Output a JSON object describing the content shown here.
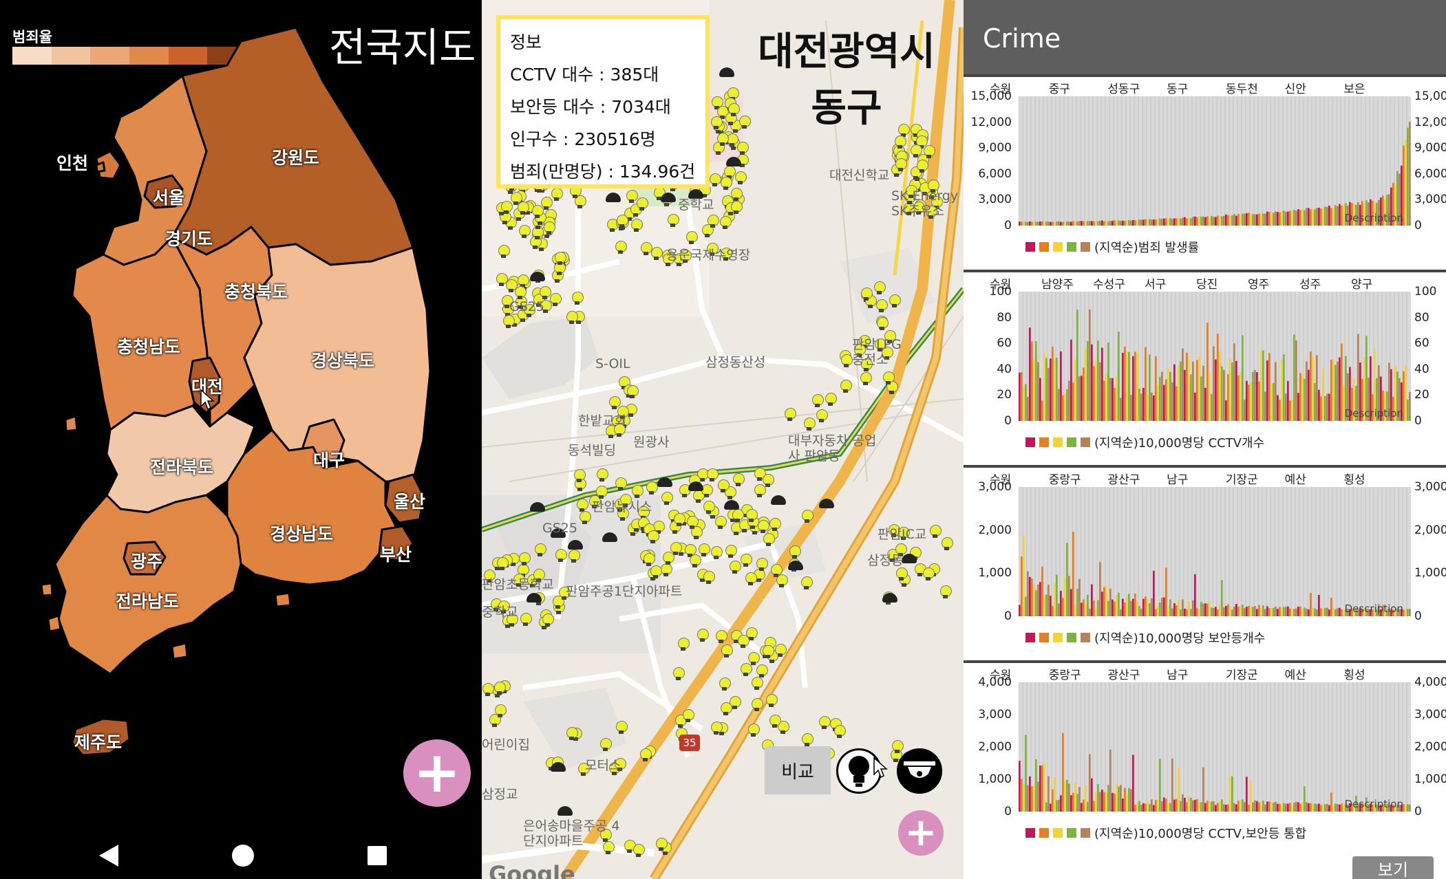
{
  "korea_map": {
    "legend_title": "범죄율",
    "legend_colors": [
      "#f7dcc6",
      "#f1c4a0",
      "#eaa876",
      "#e1894a",
      "#c9622b",
      "#8f3f17"
    ],
    "title": "전국지도",
    "regions": [
      {
        "name": "인천",
        "color": "#d47a3e"
      },
      {
        "name": "서울",
        "color": "#a85428"
      },
      {
        "name": "경기도",
        "color": "#e08a4c"
      },
      {
        "name": "강원도",
        "color": "#b45e28"
      },
      {
        "name": "충청북도",
        "color": "#e2894b"
      },
      {
        "name": "충청남도",
        "color": "#e2894b"
      },
      {
        "name": "대전",
        "color": "#b25b2a"
      },
      {
        "name": "경상북도",
        "color": "#f2bd94"
      },
      {
        "name": "전라북도",
        "color": "#f2c9a8"
      },
      {
        "name": "대구",
        "color": "#e69460"
      },
      {
        "name": "울산",
        "color": "#b4602b"
      },
      {
        "name": "경상남도",
        "color": "#e0833e"
      },
      {
        "name": "부산",
        "color": "#b25b2a"
      },
      {
        "name": "광주",
        "color": "#c96c35"
      },
      {
        "name": "전라남도",
        "color": "#e28847"
      },
      {
        "name": "제주도",
        "color": "#b25b2a"
      }
    ],
    "fab_icon": "plus-icon"
  },
  "nav_bar": {
    "back_icon": "back-triangle-icon",
    "home_icon": "home-circle-icon",
    "recents_icon": "recents-square-icon"
  },
  "district_map": {
    "info": {
      "heading": "정보",
      "cctv": "CCTV 대수  :  385대",
      "lights": "보안등 대수 :  7034대",
      "population": "인구수      :    230516명",
      "crime": "범죄(만명당) :  134.96건"
    },
    "title_line1": "대전광역시",
    "title_line2": "동구",
    "pois": [
      "대전신학교",
      "SK Energy SK주유소",
      "중학교",
      "용운국제수영장",
      "GS25",
      "S-OIL",
      "삼정동산성",
      "한밭교회",
      "원광사",
      "동석빌딩",
      "대부자동차 공업사 판암동",
      "판암LPG 충전소",
      "GS25",
      "판암IC교",
      "판암주공1단지아파트",
      "삼정동",
      "어린이집",
      "모터스",
      "은어송마을주공 4단지아파트",
      "삼정교",
      "판암뉴시스",
      "판암초등학교",
      "중학교",
      "35"
    ],
    "compare_button": "비교",
    "light_icon": "bulb-icon",
    "cctv_icon": "cctv-camera-icon",
    "fab_icon": "plus-icon",
    "google_logo": "Google"
  },
  "crime_app": {
    "title": "Crime",
    "series_colors": [
      "#c2185b",
      "#e67e22",
      "#f0d43a",
      "#7cb342",
      "#b5835a"
    ],
    "view_button": "보기",
    "charts": [
      {
        "categories": [
          "수원",
          "중구",
          "성동구",
          "동구",
          "동두천",
          "신안",
          "보은"
        ],
        "yticks": [
          "15,000",
          "12,000",
          "9,000",
          "6,000",
          "3,000",
          "0"
        ],
        "legend": "(지역순)범죄 발생률",
        "desc": "Description"
      },
      {
        "categories": [
          "수원",
          "남양주",
          "수성구",
          "서구",
          "당진",
          "영주",
          "성주",
          "양구"
        ],
        "yticks": [
          "100",
          "80",
          "60",
          "40",
          "20",
          "0"
        ],
        "legend": "(지역순)10,000명당 CCTV개수",
        "desc": "Description"
      },
      {
        "categories": [
          "수원",
          "중랑구",
          "광산구",
          "남구",
          "기장군",
          "예산",
          "횡성"
        ],
        "yticks": [
          "3,000",
          "2,000",
          "1,000",
          "0"
        ],
        "legend": "(지역순)10,000명당 보안등개수",
        "desc": "Description"
      },
      {
        "categories": [
          "수원",
          "중랑구",
          "광산구",
          "남구",
          "기장군",
          "예산",
          "횡성"
        ],
        "yticks": [
          "4,000",
          "3,000",
          "2,000",
          "1,000",
          "0"
        ],
        "legend": "(지역순)10,000명당 CCTV,보안등 통합",
        "desc": "Description"
      }
    ]
  }
}
